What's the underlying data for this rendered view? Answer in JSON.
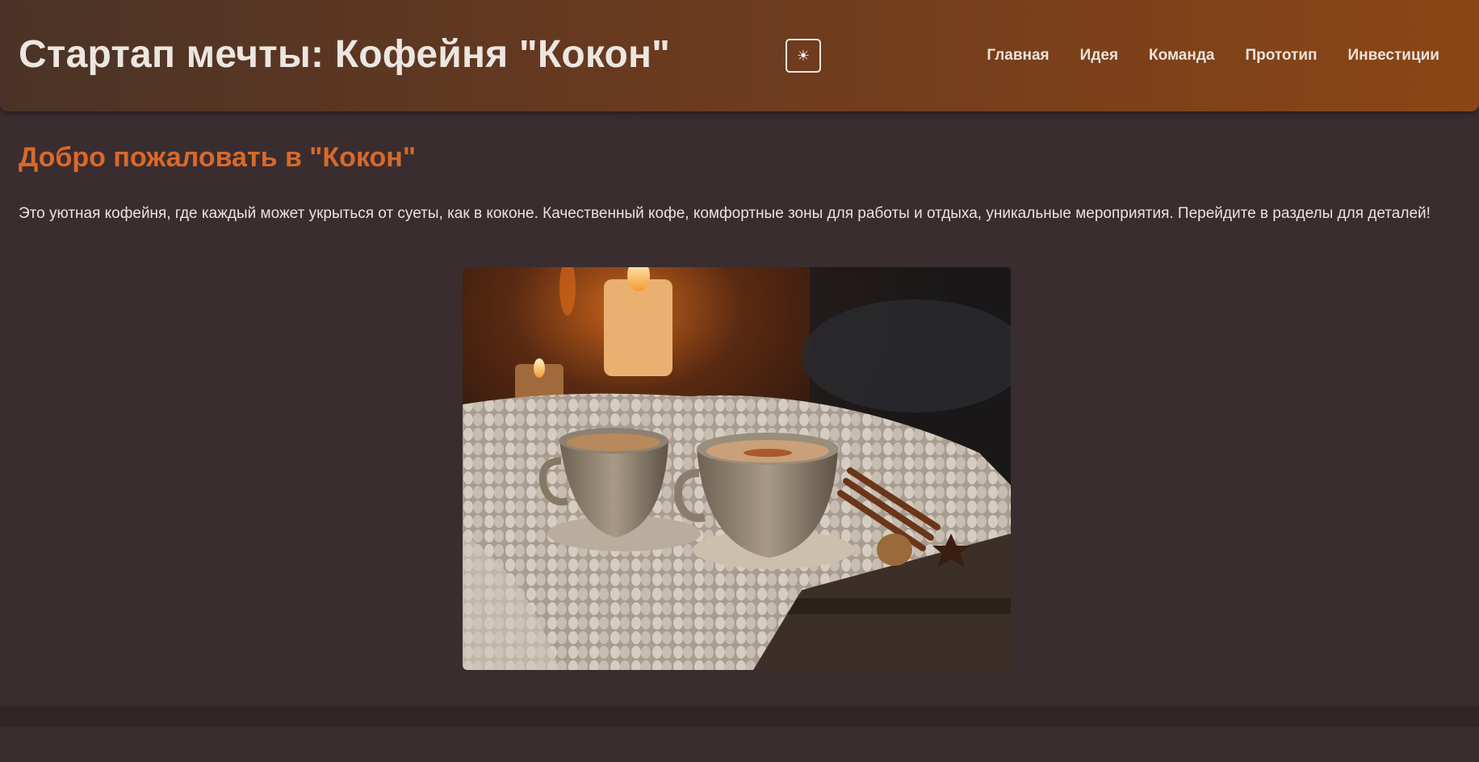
{
  "header": {
    "title": "Стартап мечты: Кофейня \"Кокон\"",
    "theme_toggle_icon": "sun-icon",
    "theme_toggle_glyph": "☀",
    "nav": [
      "Главная",
      "Идея",
      "Команда",
      "Прототип",
      "Инвестиции"
    ]
  },
  "main": {
    "heading": "Добро пожаловать в \"Кокон\"",
    "intro": "Это уютная кофейня, где каждый может укрыться от суеты, как в коконе. Качественный кофе, комфортные зоны для работы и отдыха, уникальные мероприятия. Перейдите в разделы для деталей!",
    "hero_image": "two cups of coffee on knitted blanket with candles and cinnamon"
  },
  "colors": {
    "background": "#3a2d2f",
    "header_gradient_start": "#4a3326",
    "header_gradient_end": "#8a4616",
    "accent": "#d9692a",
    "text": "#ece2dc"
  }
}
